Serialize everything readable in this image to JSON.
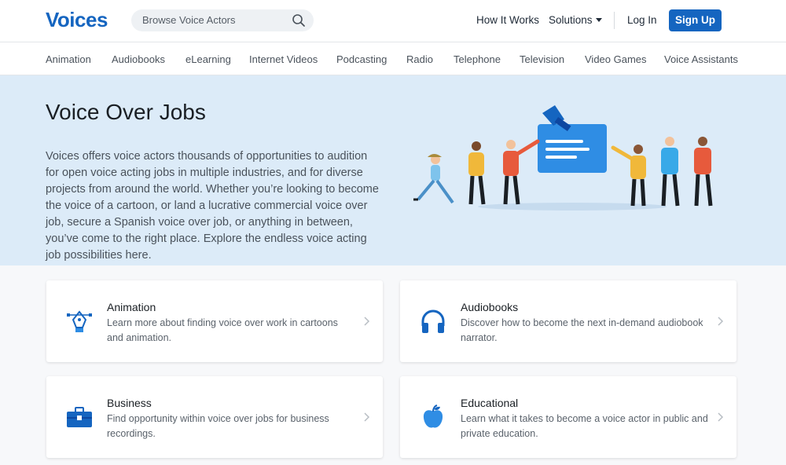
{
  "header": {
    "logo": "Voices",
    "search_placeholder": "Browse Voice Actors",
    "how_it_works": "How It Works",
    "solutions": "Solutions",
    "login": "Log In",
    "signup": "Sign Up",
    "accent_color": "#1565c0"
  },
  "categories": [
    "Animation",
    "Audiobooks",
    "eLearning",
    "Internet Videos",
    "Podcasting",
    "Radio",
    "Telephone",
    "Television",
    "Video Games",
    "Voice Assistants"
  ],
  "hero": {
    "title": "Voice Over Jobs",
    "description": "Voices offers voice actors thousands of opportunities to audition for open voice acting jobs in multiple industries, and for diverse projects from around the world. Whether you’re looking to become the voice of a cartoon, or land a lucrative commercial voice over job, secure a Spanish voice over job, or anything in between, you’ve come to the right place. Explore the endless voice acting job possibilities here.",
    "background": "#dcebf8"
  },
  "cards": [
    {
      "icon": "pen-tool-icon",
      "title": "Animation",
      "description": "Learn more about finding voice over work in cartoons and animation."
    },
    {
      "icon": "headphones-icon",
      "title": "Audiobooks",
      "description": "Discover how to become the next in-demand audiobook narrator."
    },
    {
      "icon": "briefcase-icon",
      "title": "Business",
      "description": "Find opportunity within voice over jobs for business recordings."
    },
    {
      "icon": "apple-icon",
      "title": "Educational",
      "description": "Learn what it takes to become a voice actor in public and private education."
    }
  ]
}
